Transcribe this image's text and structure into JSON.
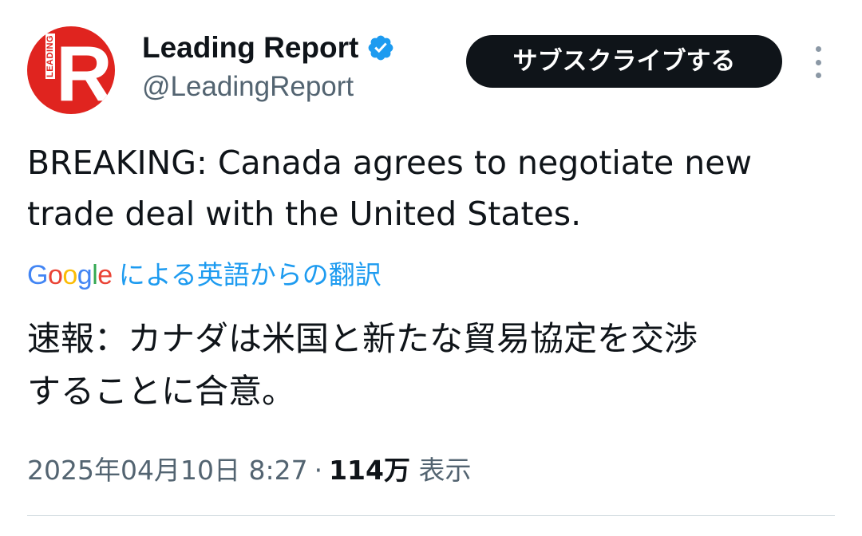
{
  "account": {
    "display_name": "Leading Report",
    "handle": "@LeadingReport",
    "avatar_letter": "R",
    "avatar_side_text": "LEADING",
    "verified": true,
    "avatar_color": "#e0241f",
    "verified_color": "#1d9bf0"
  },
  "actions": {
    "subscribe_label": "サブスクライブする",
    "more_icon": "more-vertical-icon"
  },
  "tweet": {
    "text": "BREAKING: Canada agrees to negotiate new\ntrade deal with the United States.",
    "translation_provider": "Google",
    "translation_label": "による英語からの翻訳",
    "translated_text": "速報：カナダは米国と新たな貿易協定を交渉\nすることに合意。"
  },
  "meta": {
    "timestamp": "2025年04月10日 8:27",
    "separator": "·",
    "views_count": "114万",
    "views_label": "表示"
  }
}
